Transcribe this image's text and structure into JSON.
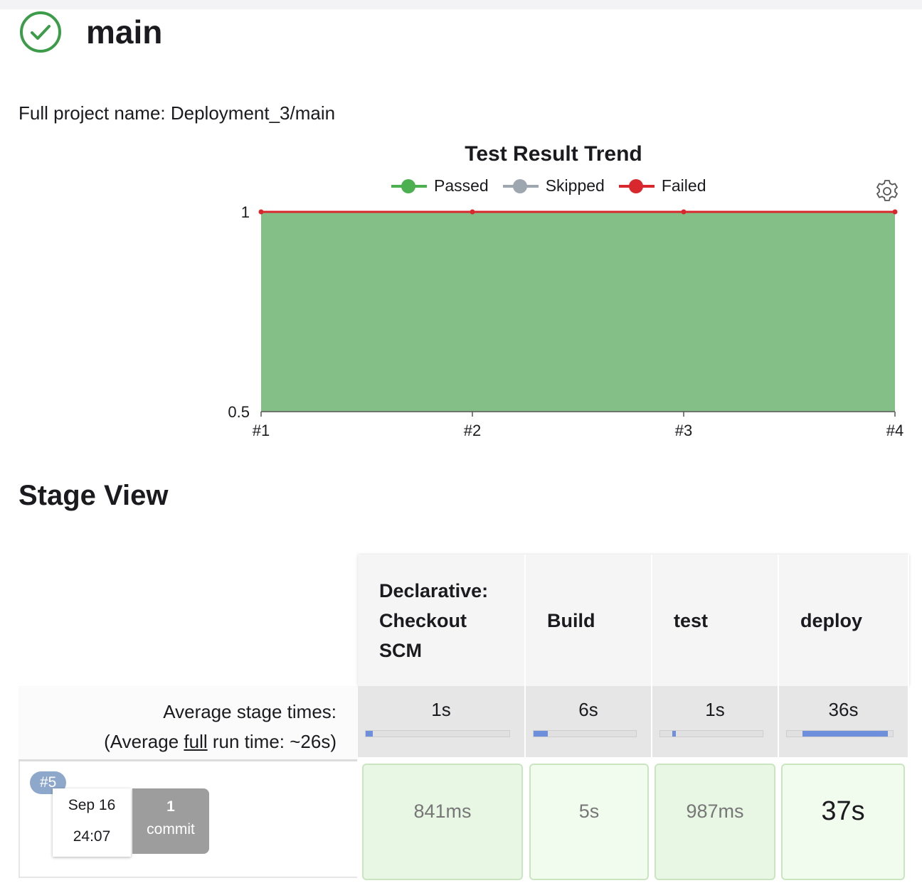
{
  "header": {
    "job_title": "main",
    "status_icon": "check-circle-icon",
    "project_label": "Full project name: Deployment_3/main"
  },
  "chart_data": {
    "type": "area",
    "title": "Test Result Trend",
    "categories": [
      "#1",
      "#2",
      "#3",
      "#4"
    ],
    "yticks": [
      "1",
      "0.5"
    ],
    "ylim": [
      0.5,
      1
    ],
    "grid": false,
    "legend_position": "top",
    "series": [
      {
        "name": "Passed",
        "values": [
          1,
          1,
          1,
          1
        ],
        "color": "#4caf50"
      },
      {
        "name": "Skipped",
        "values": [
          0,
          0,
          0,
          0
        ],
        "color": "#9ea7b0"
      },
      {
        "name": "Failed",
        "values": [
          0,
          0,
          0,
          0
        ],
        "color": "#d9272e"
      }
    ]
  },
  "stage_view": {
    "heading": "Stage View",
    "avg_label_line1": "Average stage times:",
    "avg_label_prefix": "(Average ",
    "avg_label_link": "full",
    "avg_label_suffix": " run time: ~26s)",
    "stages": [
      {
        "name": "Declarative: Checkout SCM",
        "avg": "1s",
        "bar_fill": 0.05,
        "run_time": "841ms"
      },
      {
        "name": "Build",
        "avg": "6s",
        "bar_fill": 0.14,
        "run_time": "5s"
      },
      {
        "name": "test",
        "avg": "1s",
        "bar_fill": 0.03,
        "run_time": "987ms"
      },
      {
        "name": "deploy",
        "avg": "36s",
        "bar_fill": 0.8,
        "run_time": "37s"
      }
    ],
    "run": {
      "badge": "#5",
      "date": "Sep 16",
      "time": "24:07",
      "commit_count": "1",
      "commit_label": "commit"
    },
    "colors": {
      "success_cell_bg": "#e8f7e4",
      "success_cell_border": "#c9e6c1",
      "chart_fill": "#85bf88",
      "failed_line": "#d9272e"
    }
  }
}
